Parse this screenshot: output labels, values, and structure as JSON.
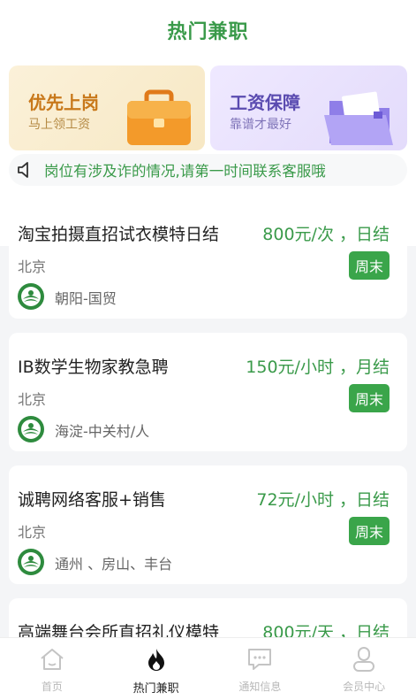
{
  "header": {
    "title": "热门兼职"
  },
  "banners": [
    {
      "title": "优先上岗",
      "subtitle": "马上领工资",
      "icon": "briefcase-icon"
    },
    {
      "title": "工资保障",
      "subtitle": "靠谱才最好",
      "icon": "folder-icon"
    }
  ],
  "notice": {
    "icon": "speaker-icon",
    "text": "岗位有涉及诈的情况,请第一时间联系客服哦"
  },
  "jobs": [
    {
      "title": "淘宝拍摄直招试衣模特日结",
      "pay": "800元/次 ，日结",
      "city": "北京",
      "badge": "周末",
      "area": "朝阳-国贸"
    },
    {
      "title": "IB数学生物家教急聘",
      "pay": "150元/小时 ，月结",
      "city": "北京",
      "badge": "周末",
      "area": "海淀-中关村/人"
    },
    {
      "title": "诚聘网络客服+销售",
      "pay": "72元/小时 ，日结",
      "city": "北京",
      "badge": "周末",
      "area": "通州 、房山、丰台"
    },
    {
      "title": "高端舞台会所直招礼仪模特",
      "pay": "800元/天 ，日结",
      "city": "",
      "badge": "",
      "area": ""
    }
  ],
  "tabs": [
    {
      "label": "首页",
      "icon": "home-icon",
      "active": false
    },
    {
      "label": "热门兼职",
      "icon": "flame-icon",
      "active": true
    },
    {
      "label": "通知信息",
      "icon": "message-icon",
      "active": false
    },
    {
      "label": "会员中心",
      "icon": "user-icon",
      "active": false
    }
  ],
  "colors": {
    "accent": "#3a9a4a",
    "badge": "#3aa54a"
  }
}
